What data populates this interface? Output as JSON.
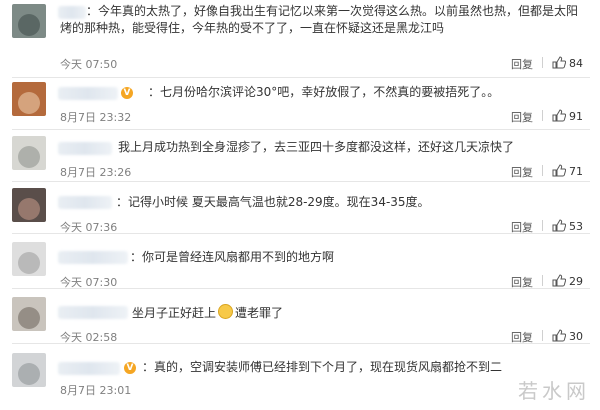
{
  "reply_label": "回复",
  "comments": [
    {
      "text": "：今年真的太热了，好像自我出生有记忆以来第一次觉得这么热。以前虽然也热，但都是太阳烤的那种热，能受得住，今年热的受不了了，一直在怀疑这还是黑龙江吗",
      "time": "今天 07:50",
      "likes": "84"
    },
    {
      "text": "：七月份哈尔滨评论30°吧，幸好放假了，不然真的要被捂死了。。",
      "time": "8月7日 23:32",
      "likes": "91"
    },
    {
      "text": "我上月成功热到全身湿疹了，去三亚四十多度都没这样，还好这几天凉快了",
      "time": "8月7日 23:26",
      "likes": "71"
    },
    {
      "text": "：记得小时候 夏天最高气温也就28-29度。现在34-35度。",
      "time": "今天 07:36",
      "likes": "53"
    },
    {
      "text": "：你可是曾经连风扇都用不到的地方啊",
      "time": "今天 07:30",
      "likes": "29"
    },
    {
      "text_before": "坐月子正好赶上",
      "text_after": "遭老罪了",
      "time": "今天 02:58",
      "likes": "30"
    },
    {
      "text": "：真的，空调安装师傅已经排到下个月了，现在现货风扇都抢不到二",
      "time": "8月7日 23:01",
      "likes": ""
    }
  ],
  "watermark": "若水网",
  "colors": {
    "vip_badge": "#f5a623",
    "emoji": "#f7c948"
  }
}
